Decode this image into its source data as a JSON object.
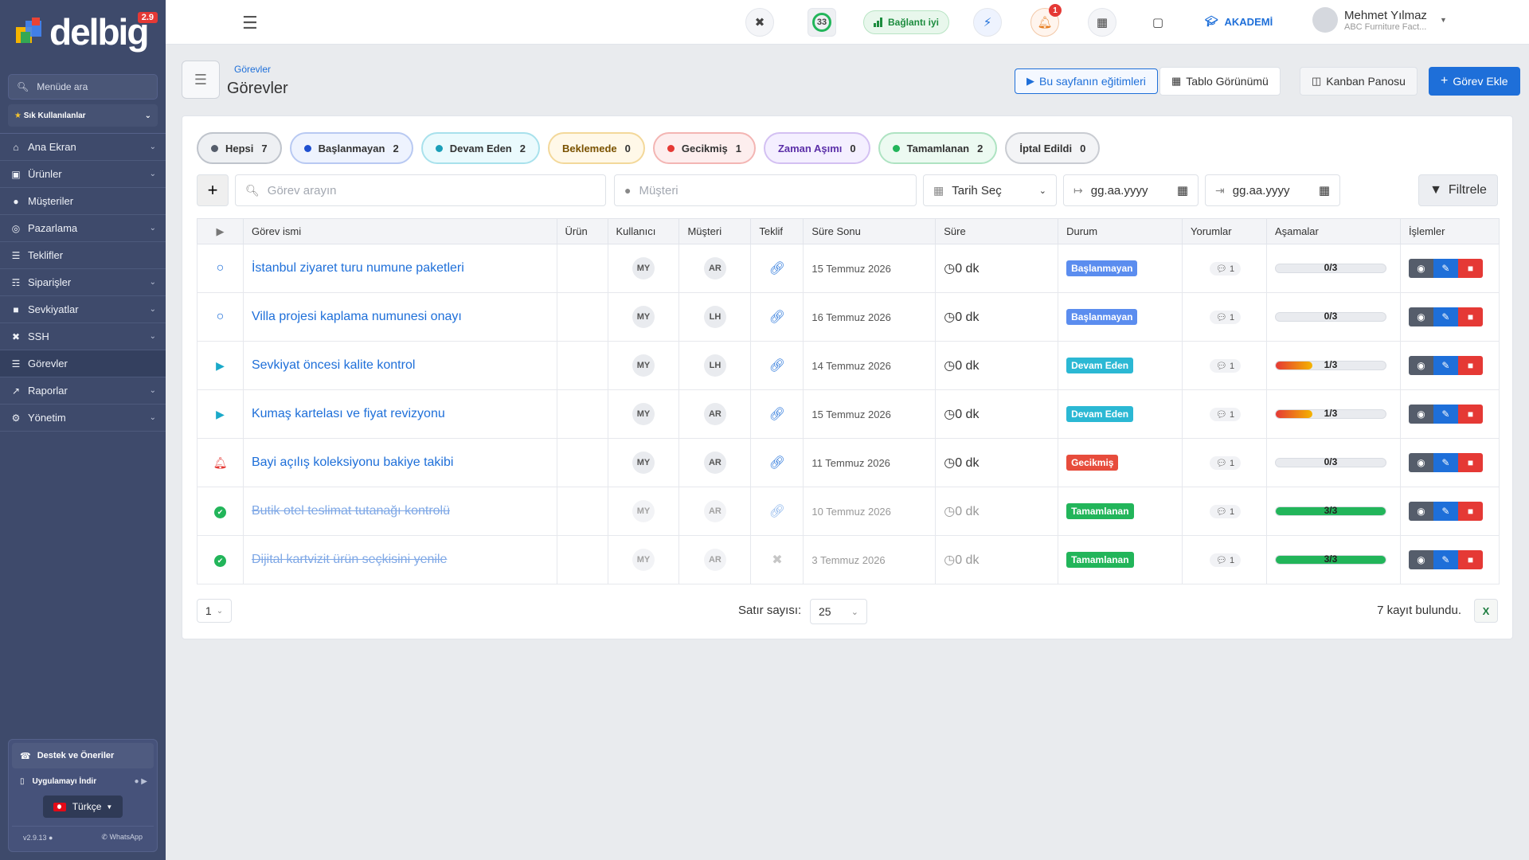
{
  "app": {
    "logo_text": "delbig",
    "version_badge": "2.9",
    "search_placeholder": "Menüde ara",
    "favorites_label": "Sık Kullanılanlar",
    "menu": [
      {
        "label": "Ana Ekran",
        "icon": "home-icon",
        "expandable": true
      },
      {
        "label": "Ürünler",
        "icon": "box-icon",
        "expandable": true
      },
      {
        "label": "Müşteriler",
        "icon": "users-icon",
        "expandable": false
      },
      {
        "label": "Pazarlama",
        "icon": "target-icon",
        "expandable": true
      },
      {
        "label": "Teklifler",
        "icon": "document-icon",
        "expandable": false
      },
      {
        "label": "Siparişler",
        "icon": "cart-icon",
        "expandable": true
      },
      {
        "label": "Sevkiyatlar",
        "icon": "truck-icon",
        "expandable": true
      },
      {
        "label": "SSH",
        "icon": "tools-icon",
        "expandable": true
      },
      {
        "label": "Görevler",
        "icon": "list-icon",
        "expandable": false,
        "active": true
      },
      {
        "label": "Raporlar",
        "icon": "chart-icon",
        "expandable": true
      },
      {
        "label": "Yönetim",
        "icon": "cogs-icon",
        "expandable": true
      }
    ],
    "support_label": "Destek ve Öneriler",
    "app_download_label": "Uygulamayı İndir",
    "language": "Türkçe",
    "version_text": "v2.9.13",
    "whatsapp_label": "WhatsApp"
  },
  "topbar": {
    "timer_value": "33",
    "connection_label": "Bağlantı iyi",
    "notification_count": "1",
    "academy_label": "AKADEMİ",
    "user_name": "Mehmet Yılmaz",
    "user_company": "ABC Furniture Fact..."
  },
  "page": {
    "breadcrumb": "Görevler",
    "title": "Görevler",
    "btn_tutorials": "Bu sayfanın eğitimleri",
    "btn_table_view": "Tablo Görünümü",
    "btn_kanban": "Kanban Panosu",
    "btn_add_task": "Görev Ekle"
  },
  "status_chips": [
    {
      "label": "Hepsi",
      "count": "7",
      "color": "#555d6b",
      "bg": "#eef0f3",
      "border": "#bfc4cc"
    },
    {
      "label": "Başlanmayan",
      "count": "2",
      "color": "#1e4fd0",
      "bg": "#eef3fe",
      "border": "#b8c9f2"
    },
    {
      "label": "Devam Eden",
      "count": "2",
      "color": "#1a9fb8",
      "bg": "#eafafd",
      "border": "#a8e1ec"
    },
    {
      "label": "Beklemede",
      "count": "0",
      "color": "#a06a00",
      "bg": "#fff8e8",
      "border": "#f3d89a"
    },
    {
      "label": "Gecikmiş",
      "count": "1",
      "color": "#e53935",
      "bg": "#fdeeee",
      "border": "#f3b5b3"
    },
    {
      "label": "Zaman Aşımı",
      "count": "0",
      "color": "#6a3ab8",
      "bg": "#f4efff",
      "border": "#d3c0f2"
    },
    {
      "label": "Tamamlanan",
      "count": "2",
      "color": "#22b55a",
      "bg": "#ecfaf1",
      "border": "#aee3c2"
    },
    {
      "label": "İptal Edildi",
      "count": "0",
      "color": "#444",
      "bg": "#f3f4f6",
      "border": "#c9ccd2"
    }
  ],
  "filters": {
    "task_search_placeholder": "Görev arayın",
    "customer_placeholder": "Müşteri",
    "date_select_label": "Tarih Seç",
    "date_from_placeholder": "gg.aa.yyyy",
    "date_to_placeholder": "gg.aa.yyyy",
    "filter_button": "Filtrele"
  },
  "table": {
    "columns": [
      "Görev ismi",
      "Ürün",
      "Kullanıcı",
      "Müşteri",
      "Teklif",
      "Süre Sonu",
      "Süre",
      "Durum",
      "Yorumlar",
      "Aşamalar",
      "İşlemler"
    ],
    "rows": [
      {
        "status_icon": "circle-icon",
        "icon_color": "#1e6fd9",
        "name": "İstanbul ziyaret turu numune paketleri",
        "product": "",
        "user": "MY",
        "customer": "AR",
        "offer_linked": true,
        "due": "15 Temmuz 2026",
        "duration": "0 dk",
        "status": "Başlanmayan",
        "status_class": "b-blue",
        "comments": "1",
        "progress_label": "0/3",
        "progress": 0,
        "done": false
      },
      {
        "status_icon": "circle-icon",
        "icon_color": "#1e6fd9",
        "name": "Villa projesi kaplama numunesi onayı",
        "product": "",
        "user": "MY",
        "customer": "LH",
        "offer_linked": true,
        "due": "16 Temmuz 2026",
        "duration": "0 dk",
        "status": "Başlanmayan",
        "status_class": "b-blue",
        "comments": "1",
        "progress_label": "0/3",
        "progress": 0,
        "done": false
      },
      {
        "status_icon": "play-icon",
        "icon_color": "#1aa9c9",
        "name": "Sevkiyat öncesi kalite kontrol",
        "product": "",
        "user": "MY",
        "customer": "LH",
        "offer_linked": true,
        "due": "14 Temmuz 2026",
        "duration": "0 dk",
        "status": "Devam Eden",
        "status_class": "b-cyan",
        "comments": "1",
        "progress_label": "1/3",
        "progress": 0.333,
        "done": false
      },
      {
        "status_icon": "play-icon",
        "icon_color": "#1aa9c9",
        "name": "Kumaş kartelası ve fiyat revizyonu",
        "product": "",
        "user": "MY",
        "customer": "AR",
        "offer_linked": true,
        "due": "15 Temmuz 2026",
        "duration": "0 dk",
        "status": "Devam Eden",
        "status_class": "b-cyan",
        "comments": "1",
        "progress_label": "1/3",
        "progress": 0.333,
        "done": false
      },
      {
        "status_icon": "bell-icon",
        "icon_color": "#e53935",
        "name": "Bayi açılış koleksiyonu bakiye takibi",
        "product": "",
        "user": "MY",
        "customer": "AR",
        "offer_linked": true,
        "due": "11 Temmuz 2026",
        "duration": "0 dk",
        "status": "Gecikmiş",
        "status_class": "b-red",
        "comments": "1",
        "progress_label": "0/3",
        "progress": 0,
        "done": false
      },
      {
        "status_icon": "check-circle-icon",
        "icon_color": "#22b55a",
        "name": "Butik otel teslimat tutanağı kontrolü",
        "product": "",
        "user": "MY",
        "customer": "AR",
        "offer_linked": true,
        "due": "10 Temmuz 2026",
        "duration": "0 dk",
        "status": "Tamamlanan",
        "status_class": "b-green",
        "comments": "1",
        "progress_label": "3/3",
        "progress": 1,
        "done": true
      },
      {
        "status_icon": "check-circle-icon",
        "icon_color": "#22b55a",
        "name": "Dijital kartvizit ürün seçkisini yenile",
        "product": "",
        "user": "MY",
        "customer": "AR",
        "offer_linked": false,
        "due": "3 Temmuz 2026",
        "duration": "0 dk",
        "status": "Tamamlanan",
        "status_class": "b-green",
        "comments": "1",
        "progress_label": "3/3",
        "progress": 1,
        "done": true
      }
    ]
  },
  "footer": {
    "page": "1",
    "rows_label": "Satır sayısı:",
    "rows_value": "25",
    "total_label": "7 kayıt bulundu."
  }
}
